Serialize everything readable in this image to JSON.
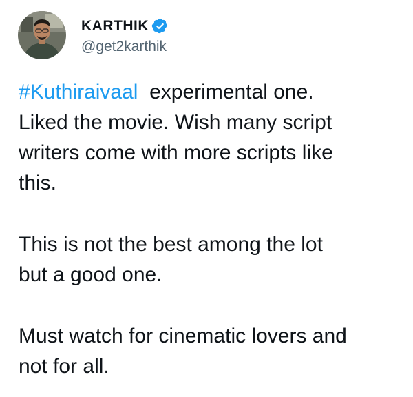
{
  "author": {
    "display_name": "KARTHIK",
    "handle": "@get2karthik",
    "verified": true
  },
  "tweet": {
    "hashtag": "#Kuthiraivaal",
    "line1_rest": "  experimental one.",
    "line2": "Liked the movie. Wish many script",
    "line3": "writers come with more scripts like",
    "line4": "this.",
    "line5": "This is not the best among the lot",
    "line6": "but a good one.",
    "line7": "Must watch for cinematic lovers and",
    "line8": "not for all."
  },
  "colors": {
    "link": "#1d9bf0",
    "verified_badge": "#1d9bf0",
    "text": "#0f1419",
    "muted": "#536471"
  }
}
